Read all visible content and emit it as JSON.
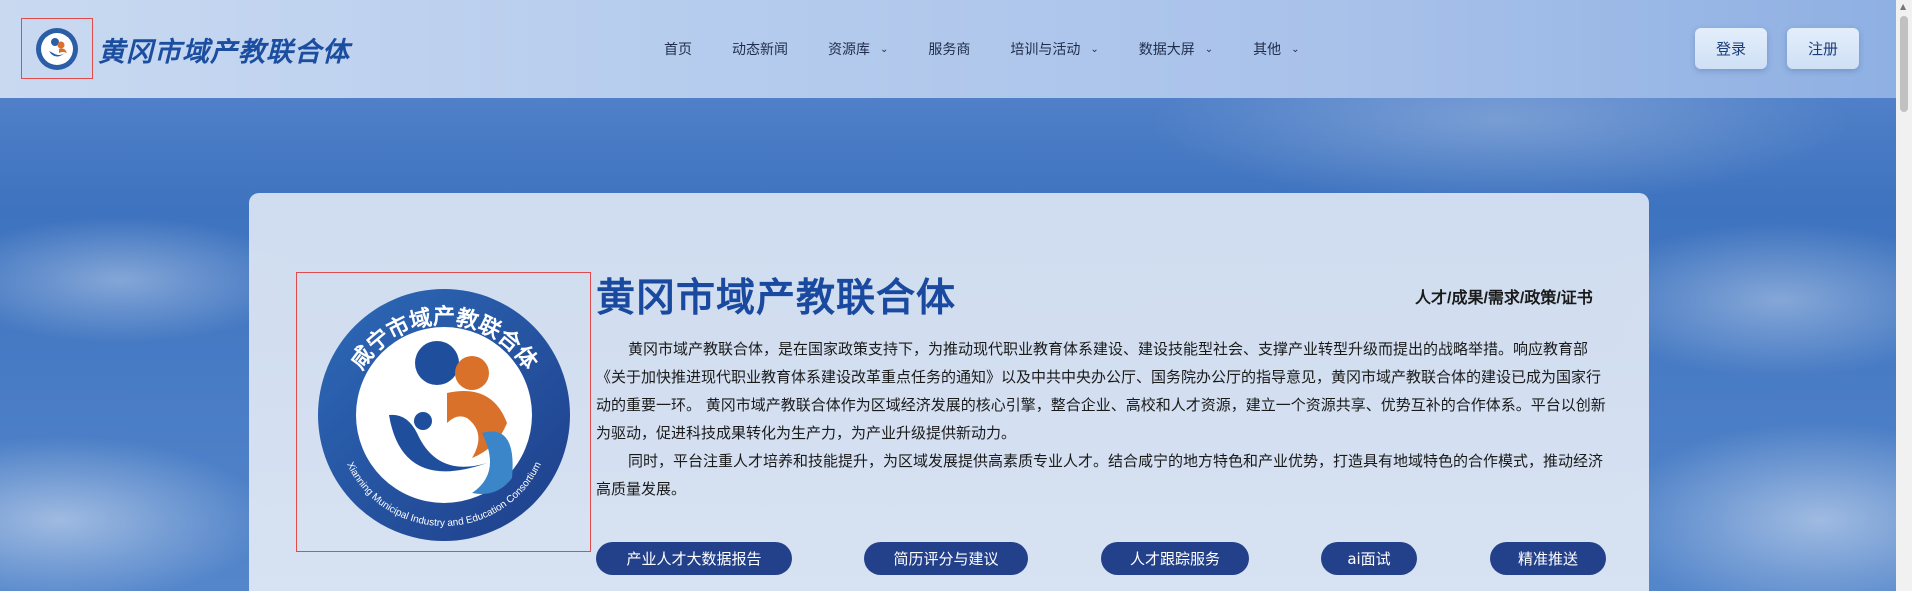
{
  "header": {
    "site_title": "黄冈市域产教联合体",
    "nav": [
      {
        "label": "首页",
        "has_dropdown": false
      },
      {
        "label": "动态新闻",
        "has_dropdown": false
      },
      {
        "label": "资源库",
        "has_dropdown": true
      },
      {
        "label": "服务商",
        "has_dropdown": false
      },
      {
        "label": "培训与活动",
        "has_dropdown": true
      },
      {
        "label": "数据大屏",
        "has_dropdown": true
      },
      {
        "label": "其他",
        "has_dropdown": true
      }
    ],
    "login_label": "登录",
    "register_label": "注册"
  },
  "main": {
    "title": "黄冈市域产教联合体",
    "tags": "人才/成果/需求/政策/证书",
    "logo_ring_text": "咸宁市域产教联合体",
    "logo_ring_text_en": "Xianning Municipal Industry and Education Consortium",
    "paragraph1": "黄冈市域产教联合体，是在国家政策支持下，为推动现代职业教育体系建设、建设技能型社会、支撑产业转型升级而提出的战略举措。响应教育部《关于加快推进现代职业教育体系建设改革重点任务的通知》以及中共中央办公厅、国务院办公厅的指导意见，黄冈市域产教联合体的建设已成为国家行动的重要一环。 黄冈市域产教联合体作为区域经济发展的核心引擎，整合企业、高校和人才资源，建立一个资源共享、优势互补的合作体系。平台以创新为驱动，促进科技成果转化为生产力，为产业升级提供新动力。",
    "paragraph2": "同时，平台注重人才培养和技能提升，为区域发展提供高素质专业人才。结合咸宁的地方特色和产业优势，打造具有地域特色的合作模式，推动经济高质量发展。",
    "actions": [
      "产业人才大数据报告",
      "简历评分与建议",
      "人才跟踪服务",
      "ai面试",
      "精准推送"
    ]
  },
  "colors": {
    "brand_blue": "#1a4aa0",
    "button_navy": "#23408a",
    "logo_orange": "#d9712b"
  }
}
